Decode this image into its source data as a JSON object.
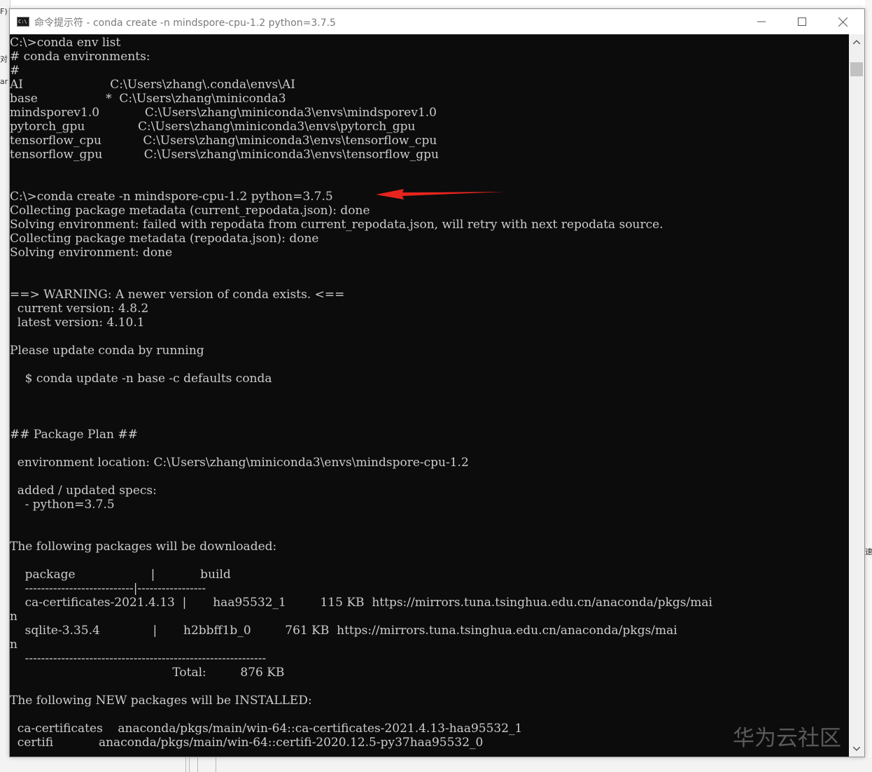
{
  "window": {
    "title": "命令提示符 - conda  create -n mindspore-cpu-1.2 python=3.7.5",
    "icon": "cmd-prompt-icon",
    "controls": [
      "minimize-icon",
      "maximize-icon",
      "close-icon"
    ]
  },
  "background_fragments": {
    "left": [
      "F)",
      "对",
      "ar"
    ],
    "right": "速"
  },
  "console": {
    "lines": [
      "C:\\>conda env list",
      "# conda environments:",
      "#",
      "AI                       C:\\Users\\zhang\\.conda\\envs\\AI",
      "base                  *  C:\\Users\\zhang\\miniconda3",
      "mindsporev1.0            C:\\Users\\zhang\\miniconda3\\envs\\mindsporev1.0",
      "pytorch_gpu              C:\\Users\\zhang\\miniconda3\\envs\\pytorch_gpu",
      "tensorflow_cpu           C:\\Users\\zhang\\miniconda3\\envs\\tensorflow_cpu",
      "tensorflow_gpu           C:\\Users\\zhang\\miniconda3\\envs\\tensorflow_gpu",
      "",
      "",
      "C:\\>conda create -n mindspore-cpu-1.2 python=3.7.5",
      "Collecting package metadata (current_repodata.json): done",
      "Solving environment: failed with repodata from current_repodata.json, will retry with next repodata source.",
      "Collecting package metadata (repodata.json): done",
      "Solving environment: done",
      "",
      "",
      "==> WARNING: A newer version of conda exists. <==",
      "  current version: 4.8.2",
      "  latest version: 4.10.1",
      "",
      "Please update conda by running",
      "",
      "    $ conda update -n base -c defaults conda",
      "",
      "",
      "",
      "## Package Plan ##",
      "",
      "  environment location: C:\\Users\\zhang\\miniconda3\\envs\\mindspore-cpu-1.2",
      "",
      "  added / updated specs:",
      "    - python=3.7.5",
      "",
      "",
      "The following packages will be downloaded:",
      "",
      "    package                    |            build",
      "    ---------------------------|-----------------",
      "    ca-certificates-2021.4.13  |       haa95532_1         115 KB  https://mirrors.tuna.tsinghua.edu.cn/anaconda/pkgs/mai",
      "n",
      "    sqlite-3.35.4              |       h2bbff1b_0         761 KB  https://mirrors.tuna.tsinghua.edu.cn/anaconda/pkgs/mai",
      "n",
      "    ------------------------------------------------------------",
      "                                           Total:         876 KB",
      "",
      "The following NEW packages will be INSTALLED:",
      "",
      "  ca-certificates    anaconda/pkgs/main/win-64::ca-certificates-2021.4.13-haa95532_1",
      "  certifi            anaconda/pkgs/main/win-64::certifi-2020.12.5-py37haa95532_0"
    ]
  },
  "watermark": "华为云社区",
  "annotation_arrow": {
    "color": "#e8241f",
    "points_to": "C:\\>conda create -n mindspore-cpu-1.2 python=3.7.5"
  },
  "scrollbar": {
    "icons": [
      "scroll-up-icon",
      "scroll-down-icon"
    ]
  }
}
